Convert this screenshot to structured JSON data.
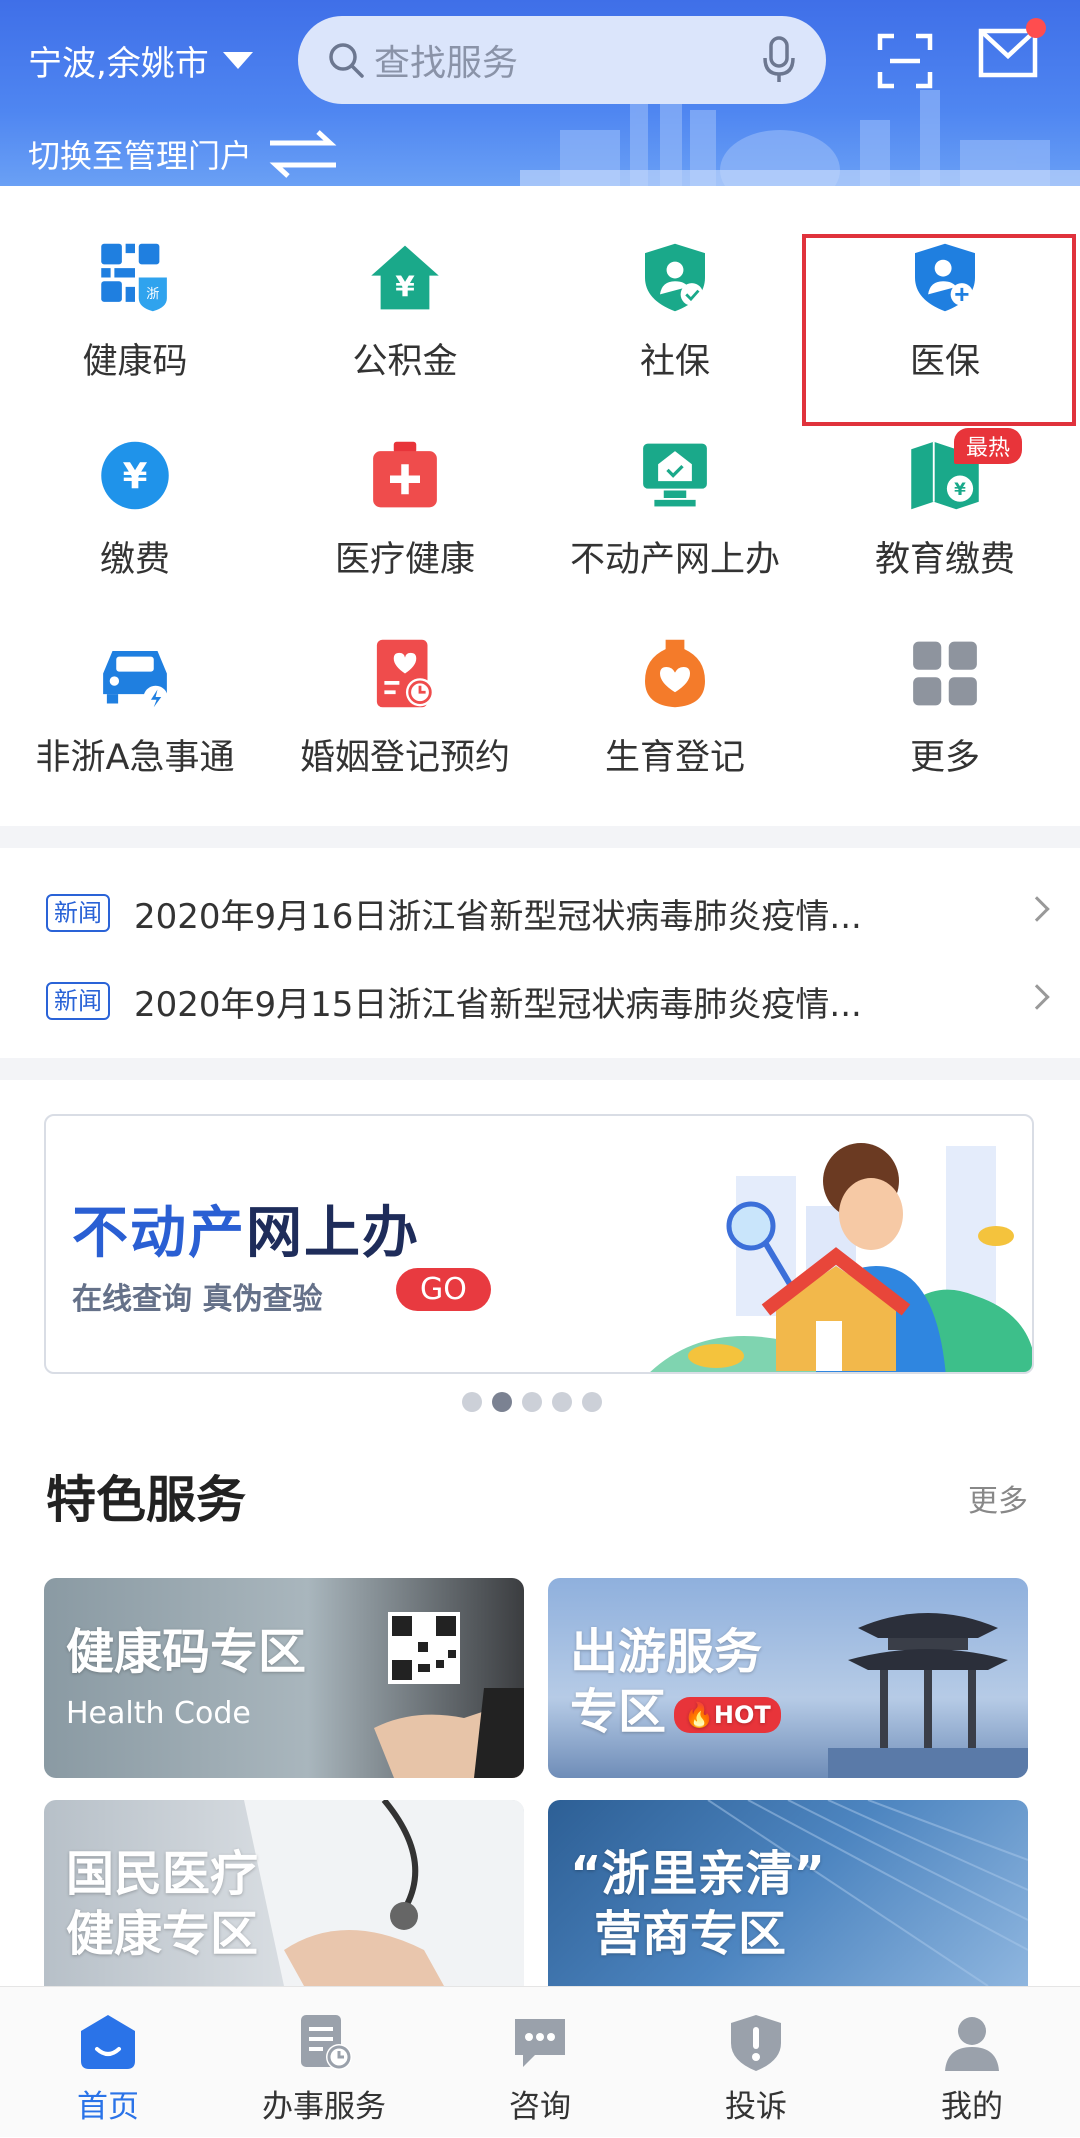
{
  "header": {
    "city": "宁波,余姚市",
    "search_placeholder": "查找服务",
    "switch_label": "切换至管理门户"
  },
  "grid": [
    {
      "label": "健康码",
      "icon": "health-code-icon"
    },
    {
      "label": "公积金",
      "icon": "housing-fund-icon"
    },
    {
      "label": "社保",
      "icon": "social-security-icon"
    },
    {
      "label": "医保",
      "icon": "medical-insurance-icon"
    },
    {
      "label": "缴费",
      "icon": "payment-icon"
    },
    {
      "label": "医疗健康",
      "icon": "medical-kit-icon"
    },
    {
      "label": "不动产网上办",
      "icon": "real-estate-icon"
    },
    {
      "label": "教育缴费",
      "icon": "education-payment-icon"
    },
    {
      "label": "非浙A急事通",
      "icon": "car-icon"
    },
    {
      "label": "婚姻登记预约",
      "icon": "marriage-registration-icon"
    },
    {
      "label": "生育登记",
      "icon": "birth-registration-icon"
    },
    {
      "label": "更多",
      "icon": "more-grid-icon"
    }
  ],
  "hot_badge": "最热",
  "news": [
    {
      "tag": "新闻",
      "text": "2020年9月16日浙江省新型冠状病毒肺炎疫情..."
    },
    {
      "tag": "新闻",
      "text": "2020年9月15日浙江省新型冠状病毒肺炎疫情..."
    }
  ],
  "banner": {
    "title_a": "不动产",
    "title_b": "网上办",
    "subtitle": "在线查询  真伪查验",
    "go": "GO"
  },
  "featured": {
    "title": "特色服务",
    "more": "更多",
    "cards": [
      {
        "title": "健康码专区",
        "subtitle": "Health Code"
      },
      {
        "title": "出游服务",
        "title2": "专区",
        "badge": "HOT"
      },
      {
        "title": "国民医疗",
        "title2": "健康专区"
      },
      {
        "title": "“浙里亲清”",
        "title2": "营商专区"
      }
    ]
  },
  "tabs": [
    {
      "label": "首页"
    },
    {
      "label": "办事服务"
    },
    {
      "label": "咨询"
    },
    {
      "label": "投诉"
    },
    {
      "label": "我的"
    }
  ],
  "colors": {
    "brand": "#2a73e8",
    "header": "#4f86f1",
    "highlight": "#e0323c",
    "hot": "#e8343a"
  }
}
